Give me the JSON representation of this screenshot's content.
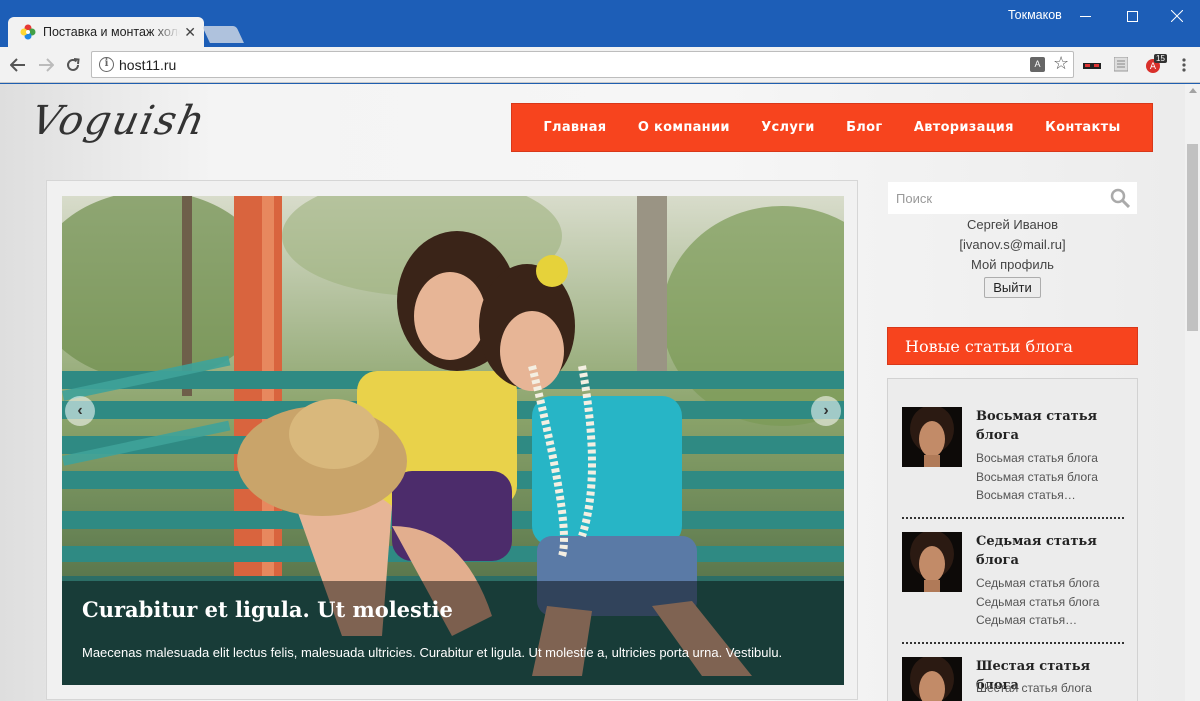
{
  "browser": {
    "tab_title": "Поставка и монтаж холо",
    "user_name": "Токмаков",
    "url": "host11.ru",
    "extension_badge": "15"
  },
  "site": {
    "logo": "Voguish",
    "nav": [
      "Главная",
      "О компании",
      "Услуги",
      "Блог",
      "Авторизация",
      "Контакты"
    ],
    "accent_color": "#f7441e"
  },
  "slider": {
    "caption_title": "Curabitur et ligula. Ut molestie",
    "caption_text": "Maecenas malesuada elit lectus felis, malesuada ultricies. Curabitur et ligula. Ut molestie a, ultricies porta urna. Vestibulu.",
    "prev_icon": "chevron-left-icon",
    "next_icon": "chevron-right-icon"
  },
  "sidebar": {
    "search_placeholder": "Поиск",
    "user": {
      "name": "Сергей Иванов",
      "email": "[ivanov.s@mail.ru]",
      "profile_link": "Мой профиль",
      "logout_label": "Выйти"
    },
    "widget_title": "Новые статьи блога",
    "posts": [
      {
        "title": "Восьмая статья блога",
        "lines": [
          "Восьмая статья блога",
          "Восьмая статья блога",
          "Восьмая статья…"
        ]
      },
      {
        "title": "Седьмая статья блога",
        "lines": [
          "Седьмая статья блога",
          "Седьмая статья блога",
          "Седьмая статья…"
        ]
      },
      {
        "title": "Шестая статья блога",
        "lines": [
          "Шестая статья блога"
        ]
      }
    ]
  }
}
